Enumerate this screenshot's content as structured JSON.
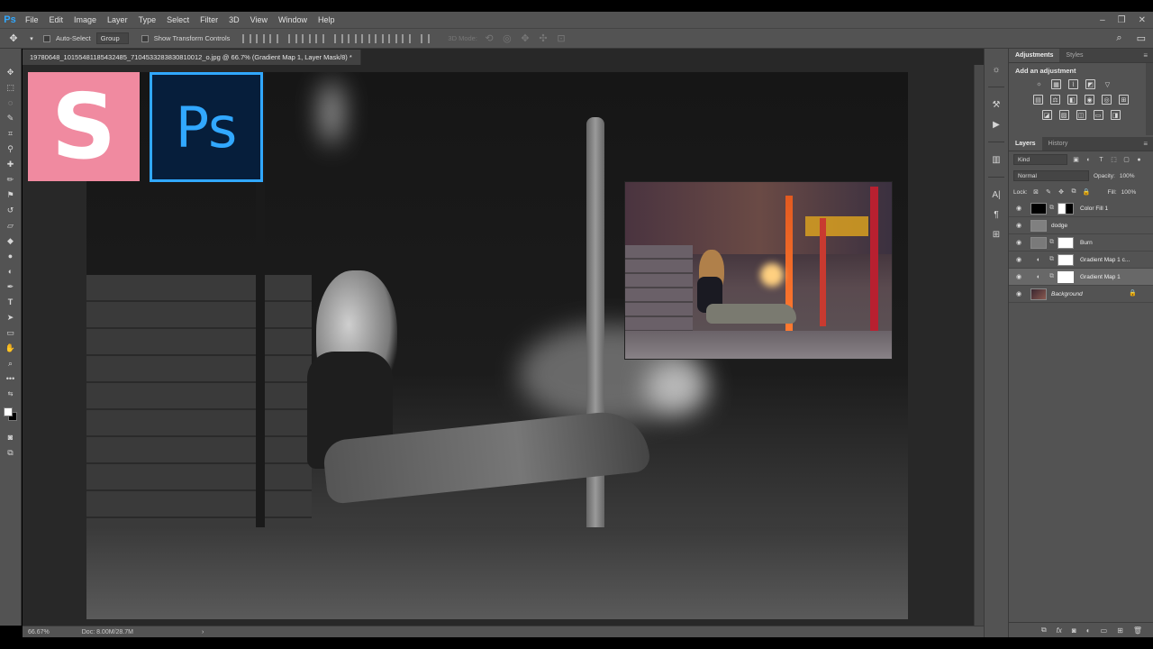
{
  "app": {
    "logo": "Ps"
  },
  "menu": [
    "File",
    "Edit",
    "Image",
    "Layer",
    "Type",
    "Select",
    "Filter",
    "3D",
    "View",
    "Window",
    "Help"
  ],
  "window_controls": {
    "minimize": "–",
    "restore": "❐",
    "close": "✕"
  },
  "options": {
    "auto_select_label": "Auto-Select",
    "group_value": "Group",
    "show_transform_label": "Show Transform Controls",
    "mode_3d_label": "3D Mode:"
  },
  "document": {
    "tab_title": "19780648_10155481185432485_7104533283830810012_o.jpg @ 66.7% (Gradient Map 1, Layer Mask/8) *",
    "close": "×"
  },
  "overlay": {
    "logo_s": "S",
    "logo_ps": "Ps"
  },
  "status": {
    "zoom": "66.67%",
    "doc": "Doc: 8.00M/28.7M",
    "arrow": "›"
  },
  "adjustments": {
    "tab_adjustments": "Adjustments",
    "tab_styles": "Styles",
    "title": "Add an adjustment"
  },
  "layers_panel": {
    "tab_layers": "Layers",
    "tab_history": "History",
    "kind_value": "Kind",
    "blend_mode": "Normal",
    "opacity_label": "Opacity:",
    "opacity_value": "100%",
    "lock_label": "Lock:",
    "fill_label": "Fill:",
    "fill_value": "100%",
    "layers": [
      {
        "name": "Color Fill 1"
      },
      {
        "name": "dodge"
      },
      {
        "name": "Burn"
      },
      {
        "name": "Gradient Map 1 c..."
      },
      {
        "name": "Gradient Map 1"
      },
      {
        "name": "Background"
      }
    ]
  },
  "icons": {
    "eye": "●",
    "link": "8",
    "lock": "🔒"
  }
}
